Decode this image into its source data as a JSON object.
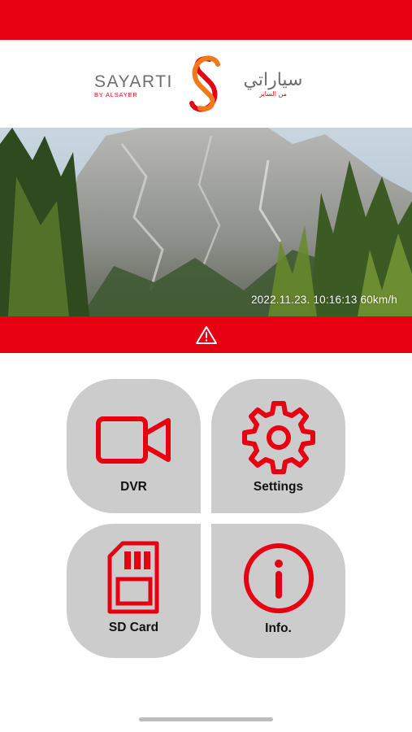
{
  "brand": {
    "name_en": "SAYARTI",
    "sub_en": "BY ALSAYER",
    "name_ar": "سياراتي",
    "sub_ar": "من الساير"
  },
  "camera": {
    "timestamp": "2022.11.23. 10:16:13 60km/h"
  },
  "alert": {
    "icon": "warning-icon"
  },
  "menu": {
    "dvr": {
      "label": "DVR",
      "icon": "video-camera-icon"
    },
    "settings": {
      "label": "Settings",
      "icon": "gear-icon"
    },
    "sd_card": {
      "label": "SD Card",
      "icon": "sd-card-icon"
    },
    "info": {
      "label": "Info.",
      "icon": "info-icon"
    }
  },
  "colors": {
    "accent": "#e60012",
    "tile": "#cccccc",
    "brand_gray": "#6e6e6e"
  }
}
